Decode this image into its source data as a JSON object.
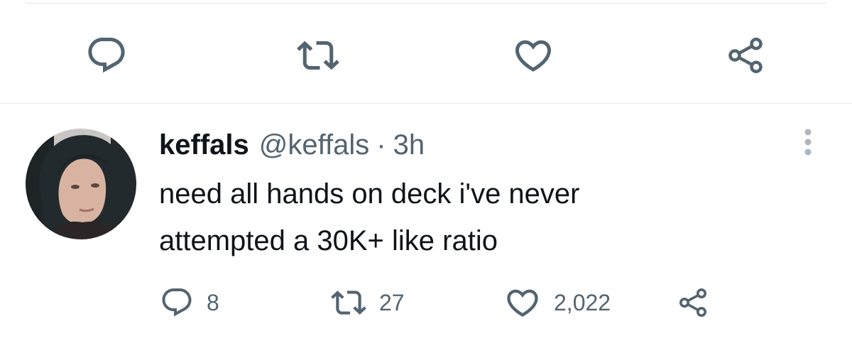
{
  "previous_tweet_actions": {
    "reply_icon": "reply-icon",
    "retweet_icon": "retweet-icon",
    "like_icon": "like-icon",
    "share_icon": "share-icon"
  },
  "tweet": {
    "display_name": "keffals",
    "handle": "@keffals",
    "separator": "·",
    "time": "3h",
    "text_line_1": "need all hands on deck i've never",
    "text_line_2": "attempted a 30K+ like ratio",
    "reply_count": "8",
    "retweet_count": "27",
    "like_count": "2,022",
    "more_icon": "more-vertical-icon"
  },
  "colors": {
    "text_primary": "#0f1419",
    "text_secondary": "#536471",
    "icon": "#536471",
    "divider": "#e4e9ec"
  }
}
